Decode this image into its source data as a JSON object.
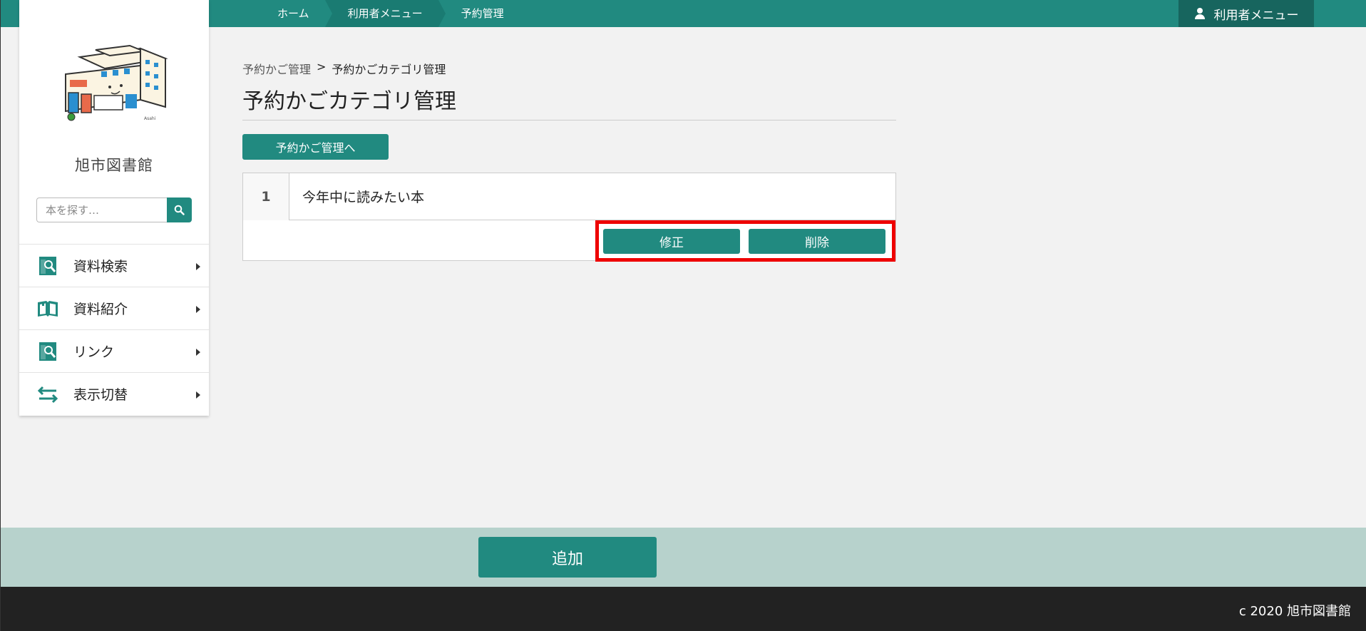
{
  "topbar": {
    "breadcrumbs": [
      "ホーム",
      "利用者メニュー",
      "予約管理"
    ],
    "user_menu_label": "利用者メニュー"
  },
  "sidebar": {
    "library_name": "旭市図書館",
    "search_placeholder": "本を探す…",
    "items": [
      {
        "label": "資料検索",
        "icon": "search-doc-icon"
      },
      {
        "label": "資料紹介",
        "icon": "open-book-icon"
      },
      {
        "label": "リンク",
        "icon": "search-doc-icon"
      },
      {
        "label": "表示切替",
        "icon": "swap-arrows-icon"
      }
    ]
  },
  "main": {
    "path_parent": "予約かご管理",
    "path_separator": ">",
    "path_current": "予約かごカテゴリ管理",
    "title": "予約かごカテゴリ管理",
    "back_button": "予約かご管理へ",
    "categories": [
      {
        "number": "1",
        "name": "今年中に読みたい本"
      }
    ],
    "edit_button": "修正",
    "delete_button": "削除"
  },
  "bottom": {
    "add_button": "追加"
  },
  "footer": {
    "copyright": "c 2020 旭市図書館"
  },
  "colors": {
    "brand": "#218a80",
    "brand_dark": "#17655e",
    "highlight": "#e00000",
    "bottom_band": "#b7d2cc",
    "footer": "#222222"
  }
}
